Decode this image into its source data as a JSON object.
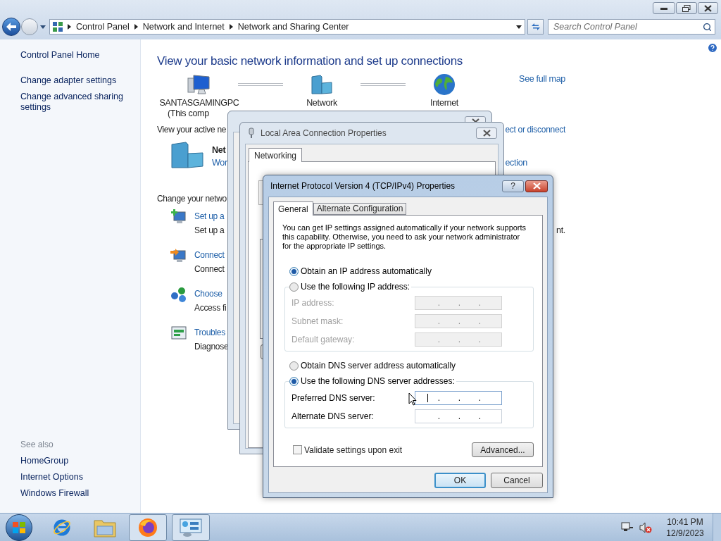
{
  "address_bar": {
    "breadcrumbs": [
      "Control Panel",
      "Network and Internet",
      "Network and Sharing Center"
    ],
    "search_placeholder": "Search Control Panel"
  },
  "sidebar": {
    "links": [
      "Control Panel Home",
      "Change adapter settings",
      "Change advanced sharing settings"
    ],
    "see_also_title": "See also",
    "see_also": [
      "HomeGroup",
      "Internet Options",
      "Windows Firewall"
    ]
  },
  "main": {
    "heading": "View your basic network information and set up connections",
    "map_nodes": [
      {
        "kind": "computer",
        "label": "SANTASGAMINGPC",
        "sublabel": "(This comp"
      },
      {
        "kind": "network",
        "label": "Network"
      },
      {
        "kind": "internet",
        "label": "Internet"
      }
    ],
    "full_map_link": "See full map",
    "active_label": "View your active ne",
    "connect_link": "ect or disconnect",
    "network_name": "Net",
    "network_type": "Wor",
    "connection_link": "ection",
    "change_label": "Change your netwo",
    "tasks": [
      {
        "kind": "setup",
        "title": "Set up a",
        "description": "Set up a",
        "description_end": "nt."
      },
      {
        "kind": "connect",
        "title": "Connect",
        "description": "Connect"
      },
      {
        "kind": "homegroup",
        "title": "Choose",
        "description": "Access fi"
      },
      {
        "kind": "troubleshoot",
        "title": "Troubles",
        "description": "Diagnose"
      }
    ]
  },
  "properties_dialog": {
    "title": "Local Area Connection Properties",
    "tabs": [
      {
        "label": "Networking",
        "selected": true
      }
    ]
  },
  "ipv4_dialog": {
    "title": "Internet Protocol Version 4 (TCP/IPv4) Properties",
    "help_button": "?",
    "tabs": [
      {
        "label": "General",
        "selected": true
      },
      {
        "label": "Alternate Configuration",
        "selected": false
      }
    ],
    "description": "You can get IP settings assigned automatically if your network supports this capability. Otherwise, you need to ask your network administrator for the appropriate IP settings.",
    "ip_mode": [
      {
        "label": "Obtain an IP address automatically",
        "selected": true
      },
      {
        "label": "Use the following IP address:",
        "selected": false
      }
    ],
    "ip_fields": [
      {
        "label": "IP address:",
        "disabled": true,
        "focused": false,
        "separators": [
          ".",
          ".",
          "."
        ]
      },
      {
        "label": "Subnet mask:",
        "disabled": true,
        "focused": false,
        "separators": [
          ".",
          ".",
          "."
        ]
      },
      {
        "label": "Default gateway:",
        "disabled": true,
        "focused": false,
        "separators": [
          ".",
          ".",
          "."
        ]
      }
    ],
    "dns_mode": [
      {
        "label": "Obtain DNS server address automatically",
        "selected": false
      },
      {
        "label": "Use the following DNS server addresses:",
        "selected": true
      }
    ],
    "dns_fields": [
      {
        "label": "Preferred DNS server:",
        "disabled": false,
        "focused": true,
        "separators": [
          ".",
          ".",
          "."
        ]
      },
      {
        "label": "Alternate DNS server:",
        "disabled": false,
        "focused": false,
        "separators": [
          ".",
          ".",
          "."
        ]
      }
    ],
    "validate": {
      "label": "Validate settings upon exit",
      "checked": false
    },
    "advanced_button": "Advanced...",
    "buttons": [
      {
        "label": "OK",
        "default": true
      },
      {
        "label": "Cancel",
        "default": false
      }
    ]
  },
  "taskbar": {
    "apps": [
      {
        "kind": "ie",
        "running": false
      },
      {
        "kind": "explorer",
        "running": false
      },
      {
        "kind": "firefox",
        "running": true
      },
      {
        "kind": "control-panel",
        "running": true
      }
    ],
    "time": "10:41 PM",
    "date": "12/9/2023"
  }
}
